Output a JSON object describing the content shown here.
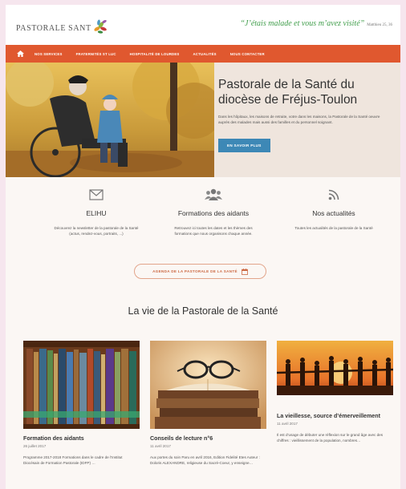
{
  "header": {
    "logo_text": "PASTORALE SANT",
    "quote": "“J’étais malade et vous m’avez visité”",
    "quote_ref": "Matthieu 25, 36"
  },
  "nav": {
    "home_icon": "home-icon",
    "items": [
      "NOS SERVICES",
      "FRATERNITÉS ST LUC",
      "HOSPITALITÉ DE LOURDES",
      "ACTUALITÉS",
      "NOUS CONTACTER"
    ]
  },
  "hero": {
    "title_line1": "Pastorale de la Santé du",
    "title_line2": "diocèse de Fréjus-Toulon",
    "body": "Dans les hôpitaux, les maisons de retraite, votre dans les maisons, la Pastorale de la Santé oeuvre auprès des malades mais aussi des familles et du personnel soignant.",
    "button": "EN SAVOIR PLUS"
  },
  "features": [
    {
      "icon": "envelope-icon",
      "title": "ELIHU",
      "desc": "Découvrez la newsletter de la pastorale de la Santé (actus, rendez-vous, portraits, ...)"
    },
    {
      "icon": "users-icon",
      "title": "Formations des aidants",
      "desc": "Retrouvez ici toutes les dates et les thèmes des formations que nous organisons chaque année."
    },
    {
      "icon": "rss-icon",
      "title": "Nos actualités",
      "desc": "Toutes les actualités de la pastorale de la Santé"
    }
  ],
  "agenda_button": "AGENDA DE LA PASTORALE DE LA SANTÉ",
  "section_title": "La vie de la Pastorale de la Santé",
  "articles": [
    {
      "title": "Formation des aidants",
      "date": "26 juillet 2017",
      "excerpt": "Programme 2017-2018 Formations dans le cadre de l’Institut Diocésain de Formation Pastorale (IDFP) …"
    },
    {
      "title": "Conseils de lecture n°6",
      "date": "11 avril 2017",
      "excerpt": "Aux portes du soin Paru en avril 2016, Edition Fidelité Etes Auteur : Doloris ALEXANDRE, religieuse du Sacré-Coeur, y enseigne…"
    },
    {
      "title": "La vieillesse, source d’émerveillement",
      "date": "11 avril 2017",
      "excerpt": "Il est d’usage de débuter une réflexion sur le grand âge avec des chiffres : vieillissement de la population, nombres…"
    }
  ],
  "colors": {
    "nav": "#e0582f",
    "button": "#3d88b6",
    "quote": "#3f9d4a"
  }
}
